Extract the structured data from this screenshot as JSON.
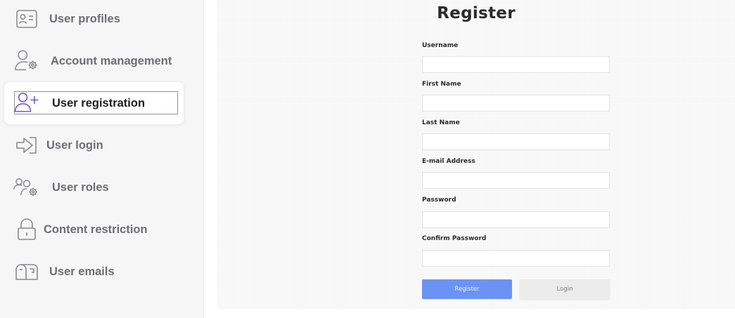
{
  "sidebar": {
    "items": [
      {
        "label": "User profiles",
        "icon": "user-profile-card-icon"
      },
      {
        "label": "Account management",
        "icon": "user-settings-icon"
      },
      {
        "label": "User registration",
        "icon": "add-user-icon",
        "active": true
      },
      {
        "label": "User login",
        "icon": "login-arrow-icon"
      },
      {
        "label": "User roles",
        "icon": "users-settings-icon"
      },
      {
        "label": "Content restriction",
        "icon": "lock-icon"
      },
      {
        "label": "User emails",
        "icon": "mailbox-icon"
      }
    ]
  },
  "form": {
    "title": "Register",
    "fields": [
      {
        "label": "Username",
        "value": ""
      },
      {
        "label": "First Name",
        "value": ""
      },
      {
        "label": "Last Name",
        "value": ""
      },
      {
        "label": "E-mail Address",
        "value": ""
      },
      {
        "label": "Password",
        "value": ""
      },
      {
        "label": "Confirm Password",
        "value": ""
      }
    ],
    "register_label": "Register",
    "login_label": "Login"
  },
  "colors": {
    "accent": "#6b93f5",
    "active_icon": "#6a4fc9",
    "icon_gray": "#8a8a8e"
  }
}
